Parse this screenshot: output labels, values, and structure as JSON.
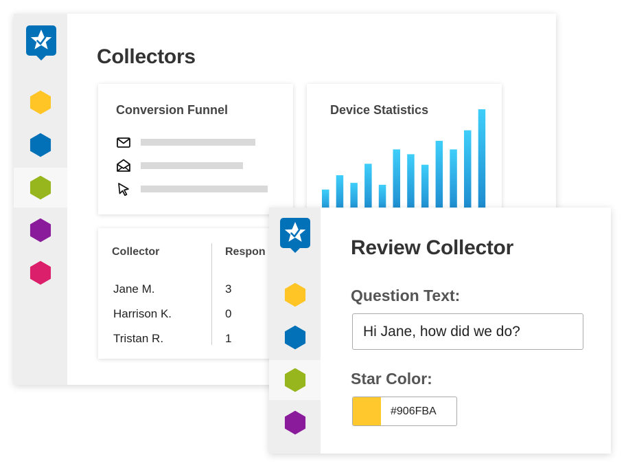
{
  "colors": {
    "brand_blue": "#0271B8",
    "nav_yellow": "#FFC527",
    "nav_blue": "#0271B8",
    "nav_green": "#97B61D",
    "nav_purple": "#8A1C9C",
    "nav_pink": "#DC1F6B",
    "bar_top": "#3FCEFA",
    "bar_bottom": "#1B87CC",
    "swatch": "#FFC82C"
  },
  "collectors_window": {
    "title": "Collectors",
    "nav": [
      "yellow-hexagon-icon",
      "blue-hexagon-icon",
      "green-hexagon-icon",
      "purple-hexagon-icon",
      "pink-hexagon-icon"
    ],
    "active_nav_index": 2,
    "funnel": {
      "title": "Conversion Funnel",
      "rows": [
        {
          "icon": "envelope-icon"
        },
        {
          "icon": "open-envelope-icon"
        },
        {
          "icon": "cursor-icon"
        }
      ]
    },
    "device": {
      "title": "Device Statistics"
    },
    "table": {
      "headers": [
        "Collector",
        "Respon"
      ],
      "rows": [
        {
          "name": "Jane M.",
          "responses": "3"
        },
        {
          "name": "Harrison K.",
          "responses": "0"
        },
        {
          "name": "Tristan R.",
          "responses": "1"
        }
      ]
    }
  },
  "review_window": {
    "title": "Review Collector",
    "nav": [
      "yellow-hexagon-icon",
      "blue-hexagon-icon",
      "green-hexagon-icon",
      "purple-hexagon-icon"
    ],
    "active_nav_index": 2,
    "question_label": "Question Text:",
    "question_value": "Hi Jane, how did we do?",
    "star_label": "Star Color:",
    "star_color_value": "#906FBA"
  },
  "chart_data": {
    "type": "bar",
    "title": "Device Statistics",
    "values": [
      0.26,
      0.41,
      0.33,
      0.53,
      0.31,
      0.68,
      0.63,
      0.52,
      0.77,
      0.68,
      0.88,
      1.1
    ],
    "ylim": [
      0,
      1.1
    ],
    "grid": false
  }
}
